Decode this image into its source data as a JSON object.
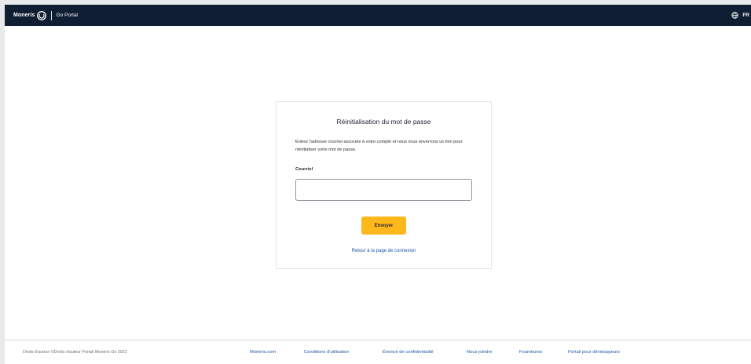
{
  "header": {
    "brand_name": "Moneris",
    "product_name": "Go Portal",
    "language": "FR",
    "icons": {
      "logo": "moneris-logo-icon",
      "language": "globe-icon"
    }
  },
  "reset_card": {
    "title": "Réinitialisation du mot de passe",
    "description": "Entrez l'adresse courriel associée à votre compte et nous vous enverrons un lien pour réinitialiser votre mot de passe.",
    "email_label": "Courriel",
    "email_value": "",
    "submit_label": "Envoyer",
    "back_link": "Retour à la page de connexion"
  },
  "footer": {
    "copyright": "Droits d'auteur ©Droits d'auteur Portail Moneris Go 2022",
    "links": [
      "Moneris.com",
      "Conditions d'utilisation",
      "Énoncé de confidentialité",
      "Nous joindre",
      "Fournitures",
      "Portail pour développeurs"
    ]
  },
  "colors": {
    "header_bg": "#0f1e33",
    "accent": "#ffb81c",
    "link": "#1c57a5"
  }
}
